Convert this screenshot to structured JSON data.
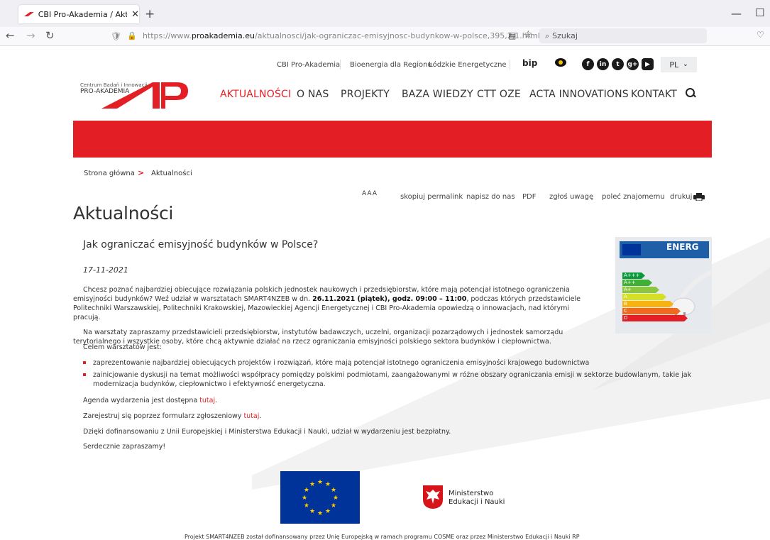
{
  "browser": {
    "tab_title": "CBI Pro-Akademia / Aktualnośc",
    "new_tab_symbol": "+",
    "url_prefix": "https://www.",
    "url_domain": "proakademia.eu",
    "url_path": "/aktualnosci/jak-ograniczac-emisyjnosc-budynkow-w-polsce,395,2,1.html",
    "search_placeholder": "Szukaj"
  },
  "top_links": [
    "CBI Pro-Akademia",
    "Bioenergia dla Regionu",
    "Łódzkie Energetyczne"
  ],
  "bip_label": "bip",
  "social_icons": [
    "facebook-icon",
    "linkedin-icon",
    "twitter-icon",
    "google-plus-icon",
    "youtube-icon"
  ],
  "language": "PL",
  "logo": {
    "line1": "Centrum Badań i Innowacji",
    "line2": "PRO-AKADEMIA"
  },
  "main_menu": [
    "AKTUALNOŚCI",
    "O NAS",
    "PROJEKTY",
    "BAZA WIEDZY",
    "CTT OZE",
    "ACTA INNOVATIONS",
    "KONTAKT"
  ],
  "breadcrumb": {
    "home": "Strona główna",
    "separator": ">",
    "current": "Aktualności"
  },
  "tools": {
    "font_size": "AAA",
    "permalink": "skopiuj permalink",
    "write": "napisz do nas",
    "pdf": "PDF",
    "report": "zgłoś uwagę",
    "recommend": "poleć znajomemu",
    "print": "drukuj"
  },
  "page_title": "Aktualności",
  "article": {
    "title": "Jak ograniczać emisyjność budynków w Polsce?",
    "date": "17-11-2021",
    "p1_a": "Chcesz poznać najbardziej obiecujące rozwiązania polskich jednostek naukowych i przedsiębiorstw, które mają potencjał istotnego ograniczenia emisyjności budynków? Weź udział w warsztatach SMART4NZEB w dn. ",
    "p1_bold": "26.11.2021 (piątek), godz. 09:00 – 11:00",
    "p1_b": ", podczas których przedstawiciele Politechniki Warszawskiej, Politechniki Krakowskiej, Mazowieckiej Agencji Energetycznej i CBI Pro-Akademia opowiedzą o innowacjach, nad którymi pracują.",
    "p2": "Na warsztaty zapraszamy przedstawicieli przedsiębiorstw, instytutów badawczych, uczelni, organizacji pozarządowych i jednostek samorządu terytorialnego i wszystkie osoby, które chcą aktywnie działać na rzecz ograniczania emisyjności polskiego sektora budynków i ciepłownictwa.",
    "goal_intro": "Celem warsztatów jest:",
    "bullets": [
      "zaprezentowanie najbardziej obiecujących projektów i rozwiązań, które mają potencjał istotnego ograniczenia emisyjności krajowego budownictwa",
      "zainicjowanie dyskusji na temat możliwości współpracy pomiędzy polskimi podmiotami, zaangażowanymi w różne obszary ograniczania emisji w sektorze budowlanym, takie jak modernizacja budynków, ciepłownictwo i efektywność energetyczna."
    ],
    "agenda_text": "Agenda wydarzenia jest dostępna ",
    "agenda_link": "tutaj",
    "agenda_end": ".",
    "register_text": "Zarejestruj się poprzez formularz zgłoszeniowy ",
    "register_link": "tutaj",
    "register_end": ".",
    "funding": "Dzięki dofinansowaniu z Unii Europejskiej i Ministerstwa Edukacji i Nauki, udział w wydarzeniu jest bezpłatny.",
    "closing": "Serdecznie zapraszamy!"
  },
  "energy_image": {
    "label_top": "ENERG",
    "classes": [
      "A+++",
      "A++",
      "A+",
      "A",
      "B",
      "C",
      "D"
    ],
    "colors": [
      "#0a9a3a",
      "#3fb034",
      "#8cc63f",
      "#d7df23",
      "#f7b30f",
      "#ef6b1f",
      "#e31e24"
    ]
  },
  "ministry": {
    "line1": "Ministerstwo",
    "line2": "Edukacji i Nauki"
  },
  "footer_note": "Projekt SMART4NZEB został dofinansowany przez Unię Europejską w ramach programu COSME oraz przez Ministerstwo Edukacji i Nauki RP",
  "colors": {
    "accent": "#e31e24",
    "eu_blue": "#003399",
    "eu_star": "#ffcc00"
  }
}
